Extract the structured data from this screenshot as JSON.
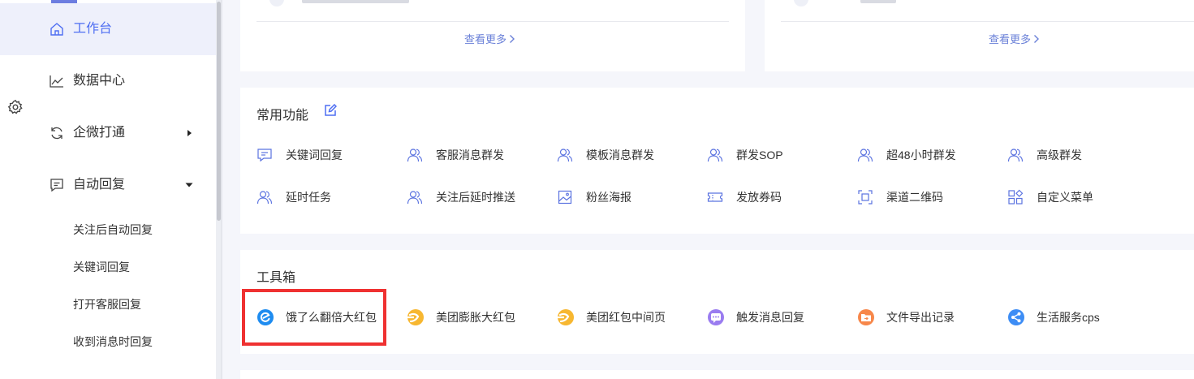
{
  "sidebar": {
    "items": [
      {
        "label": "工作台",
        "icon": "home-icon",
        "active": true
      },
      {
        "label": "数据中心",
        "icon": "line-chart-icon"
      },
      {
        "label": "企微打通",
        "icon": "refresh-icon",
        "arrow": "caret-right-icon"
      },
      {
        "label": "自动回复",
        "icon": "message-icon",
        "arrow": "caret-down-icon"
      }
    ],
    "sub_items": [
      {
        "label": "关注后自动回复"
      },
      {
        "label": "关键词回复"
      },
      {
        "label": "打开客服回复"
      },
      {
        "label": "收到消息时回复"
      }
    ]
  },
  "top_cards": [
    {
      "more_label": "查看更多"
    },
    {
      "more_label": "查看更多"
    }
  ],
  "common": {
    "title": "常用功能",
    "edit_icon": "edit-icon",
    "items": [
      {
        "label": "关键词回复",
        "icon": "message-square-icon"
      },
      {
        "label": "客服消息群发",
        "icon": "users-icon"
      },
      {
        "label": "模板消息群发",
        "icon": "users-icon"
      },
      {
        "label": "群发SOP",
        "icon": "users-icon"
      },
      {
        "label": "超48小时群发",
        "icon": "users-icon"
      },
      {
        "label": "高级群发",
        "icon": "users-icon"
      },
      {
        "label": "延时任务",
        "icon": "users-icon"
      },
      {
        "label": "关注后延时推送",
        "icon": "users-icon"
      },
      {
        "label": "粉丝海报",
        "icon": "image-icon"
      },
      {
        "label": "发放券码",
        "icon": "ticket-icon"
      },
      {
        "label": "渠道二维码",
        "icon": "scan-frame-icon"
      },
      {
        "label": "自定义菜单",
        "icon": "grid-menu-icon"
      }
    ]
  },
  "toolbox": {
    "title": "工具箱",
    "items": [
      {
        "label": "饿了么翻倍大红包",
        "icon": "eleme-icon",
        "color": "#1e8cf0"
      },
      {
        "label": "美团膨胀大红包",
        "icon": "meituan-icon",
        "color": "#f7b731"
      },
      {
        "label": "美团红包中间页",
        "icon": "meituan-icon",
        "color": "#f7b731"
      },
      {
        "label": "触发消息回复",
        "icon": "chat-bubble-icon",
        "color": "#9a7cf0"
      },
      {
        "label": "文件导出记录",
        "icon": "folder-icon",
        "color": "#f7874a"
      },
      {
        "label": "生活服务cps",
        "icon": "share-icon",
        "color": "#3d8df5"
      }
    ]
  },
  "colors": {
    "accent": "#4e6ef2",
    "highlight": "#ef3131",
    "link": "#6a80d8"
  }
}
